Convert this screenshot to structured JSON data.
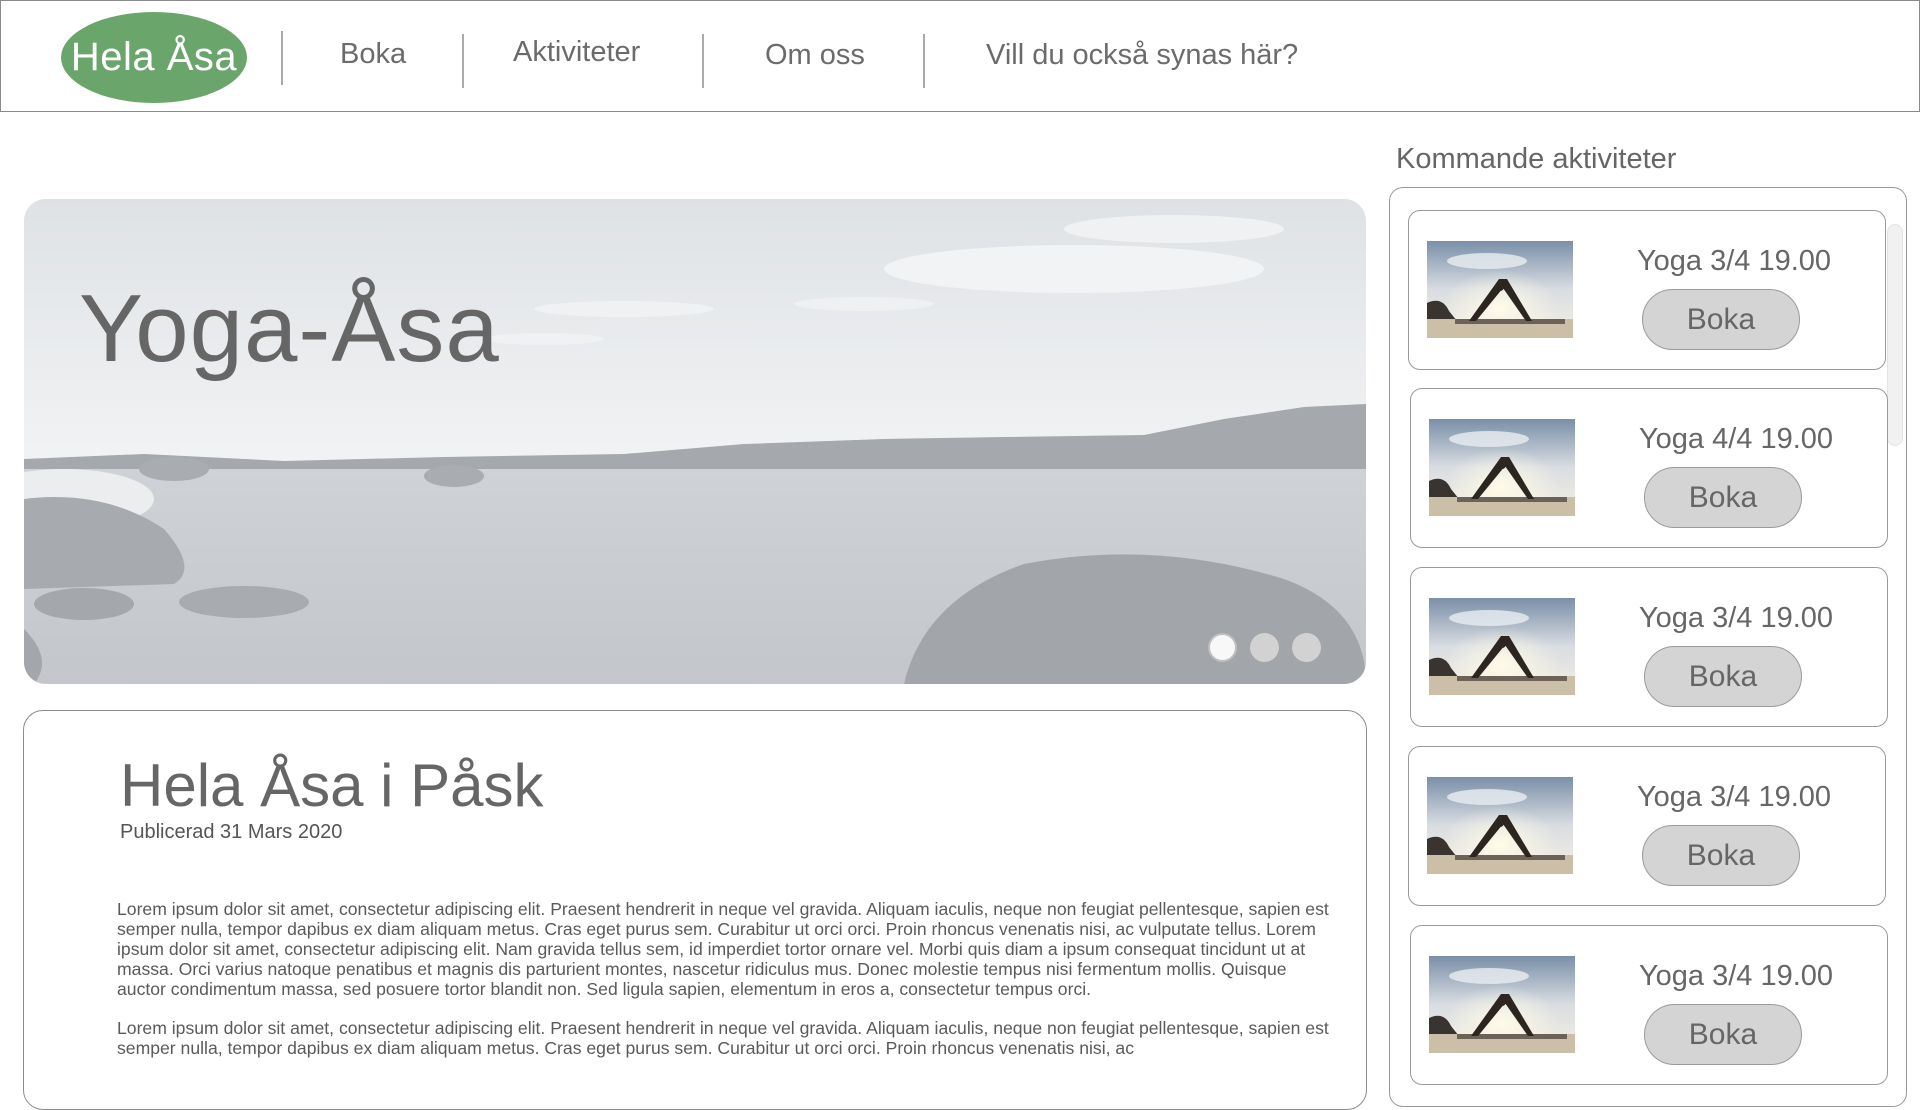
{
  "nav": {
    "logo": "Hela Åsa",
    "links": [
      "Boka",
      "Aktiviteter",
      "Om oss",
      "Vill du också synas här?"
    ]
  },
  "hero": {
    "title": "Yoga-Åsa",
    "slides": 3,
    "active_slide": 1
  },
  "article": {
    "title": "Hela Åsa i Påsk",
    "published": "Publicerad 31 Mars 2020",
    "paragraphs": [
      "Lorem ipsum dolor sit amet, consectetur adipiscing elit. Praesent hendrerit in neque vel gravida. Aliquam iaculis, neque non feugiat pellentesque, sapien est semper nulla, tempor dapibus ex diam aliquam metus. Cras eget purus sem. Curabitur ut orci orci. Proin rhoncus venenatis nisi, ac vulputate tellus. Lorem ipsum dolor sit amet, consectetur adipiscing elit. Nam gravida tellus sem, id imperdiet tortor ornare vel. Morbi quis diam a ipsum consequat tincidunt ut at massa. Orci varius natoque penatibus et magnis dis parturient montes, nascetur ridiculus mus. Donec molestie tempus nisi fermentum mollis. Quisque auctor condimentum massa, sed posuere tortor blandit non. Sed ligula sapien, elementum in eros a, consectetur tempus orci.",
      "Lorem ipsum dolor sit amet, consectetur adipiscing elit. Praesent hendrerit in neque vel gravida. Aliquam iaculis, neque non feugiat pellentesque, sapien est semper nulla, tempor dapibus ex diam aliquam metus. Cras eget purus sem. Curabitur ut orci orci. Proin rhoncus venenatis nisi, ac"
    ]
  },
  "sidebar": {
    "heading": "Kommande aktiviteter",
    "items": [
      {
        "title": "Yoga 3/4 19.00",
        "button": "Boka"
      },
      {
        "title": "Yoga 4/4 19.00",
        "button": "Boka"
      },
      {
        "title": "Yoga 3/4 19.00",
        "button": "Boka"
      },
      {
        "title": "Yoga 3/4 19.00",
        "button": "Boka"
      },
      {
        "title": "Yoga 3/4 19.00",
        "button": "Boka"
      }
    ]
  },
  "colors": {
    "logo_green": "#6aa56c",
    "text_gray": "#666666",
    "button_gray": "#d4d4d4"
  }
}
